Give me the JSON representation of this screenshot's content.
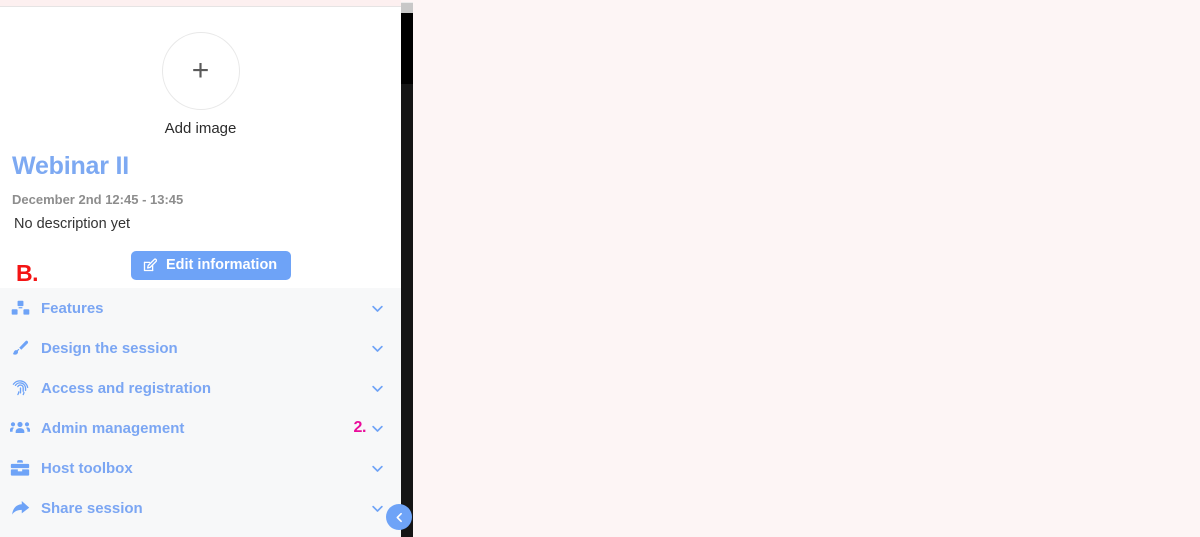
{
  "colors": {
    "accent_blue": "#6ea3f7",
    "title_blue": "#7da9f2",
    "annot_red": "#f41414",
    "annot_magenta": "#ea0c9b",
    "menu_bg": "#f7f8f9",
    "page_bg": "#fdf5f5"
  },
  "panel": {
    "add_image": {
      "icon": "plus-icon",
      "plus_glyph": "+",
      "label": "Add image"
    },
    "session": {
      "title": "Webinar II",
      "time": "December 2nd 12:45 - 13:45",
      "description": "No description yet"
    },
    "edit_button": {
      "label": "Edit information",
      "icon": "edit-pencil-square-icon"
    },
    "annotations": {
      "b_marker": "B.",
      "two_marker": "2."
    },
    "menu": [
      {
        "label": "Features",
        "icon": "cubes-icon",
        "chevron": "chevron-down-icon",
        "annotation": ""
      },
      {
        "label": "Design the session",
        "icon": "paint-brush-icon",
        "chevron": "chevron-down-icon",
        "annotation": ""
      },
      {
        "label": "Access and registration",
        "icon": "fingerprint-icon",
        "chevron": "chevron-down-icon",
        "annotation": ""
      },
      {
        "label": "Admin management",
        "icon": "users-icon",
        "chevron": "chevron-down-icon",
        "annotation": "2."
      },
      {
        "label": "Host toolbox",
        "icon": "toolbox-icon",
        "chevron": "chevron-down-icon",
        "annotation": ""
      },
      {
        "label": "Share session",
        "icon": "share-arrow-icon",
        "chevron": "chevron-down-icon",
        "annotation": ""
      }
    ],
    "collapse_button": {
      "icon": "chevron-left-icon"
    }
  }
}
